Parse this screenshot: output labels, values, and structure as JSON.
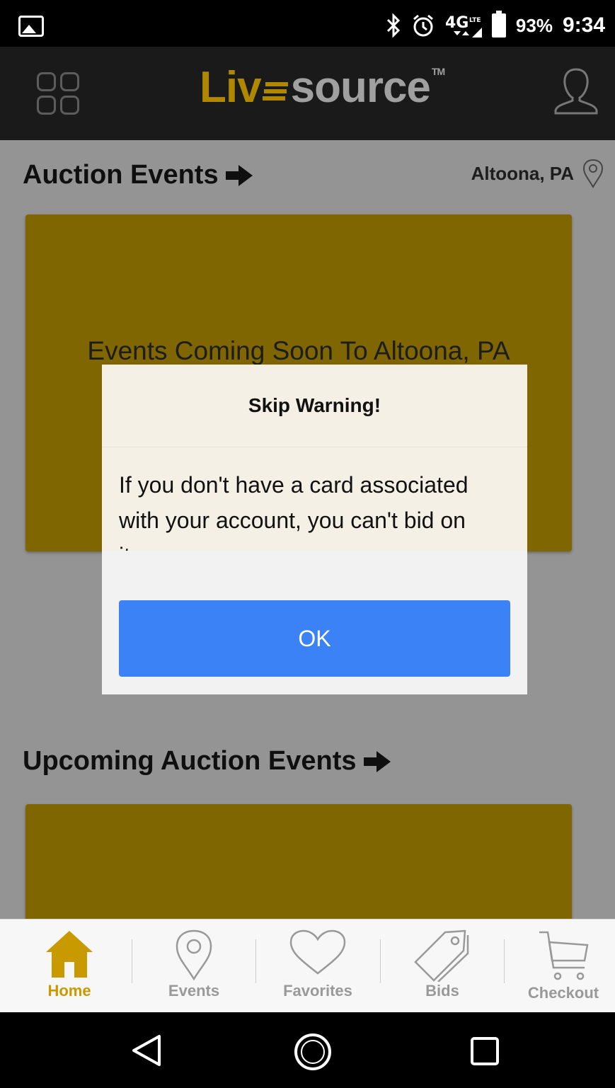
{
  "status_bar": {
    "battery": "93%",
    "time": "9:34",
    "icons": [
      "gallery-icon",
      "bluetooth-icon",
      "alarm-icon",
      "4g-lte-icon",
      "signal-icon",
      "battery-icon"
    ]
  },
  "header": {
    "logo_part1": "Liv",
    "logo_part2": "source",
    "logo_tm": "TM"
  },
  "auction_events": {
    "title": "Auction Events",
    "location": "Altoona, PA",
    "card_text": "Events Coming Soon To Altoona, PA"
  },
  "upcoming_events": {
    "title": "Upcoming Auction Events"
  },
  "dialog": {
    "title": "Skip Warning!",
    "message": "If you don't have a card associated with your account, you can't bid on items.",
    "ok_label": "OK"
  },
  "bottom_nav": {
    "items": [
      {
        "label": "Home",
        "icon": "home-icon",
        "active": true
      },
      {
        "label": "Events",
        "icon": "location-pin-icon",
        "active": false
      },
      {
        "label": "Favorites",
        "icon": "heart-icon",
        "active": false
      },
      {
        "label": "Bids",
        "icon": "tag-icon",
        "active": false
      },
      {
        "label": "Checkout",
        "icon": "cart-icon",
        "active": false
      }
    ]
  },
  "colors": {
    "brand_gold": "#ddb000",
    "logo_gold": "#b08800",
    "button_blue": "#3a82f6",
    "header_bg": "#1a1a1a"
  }
}
